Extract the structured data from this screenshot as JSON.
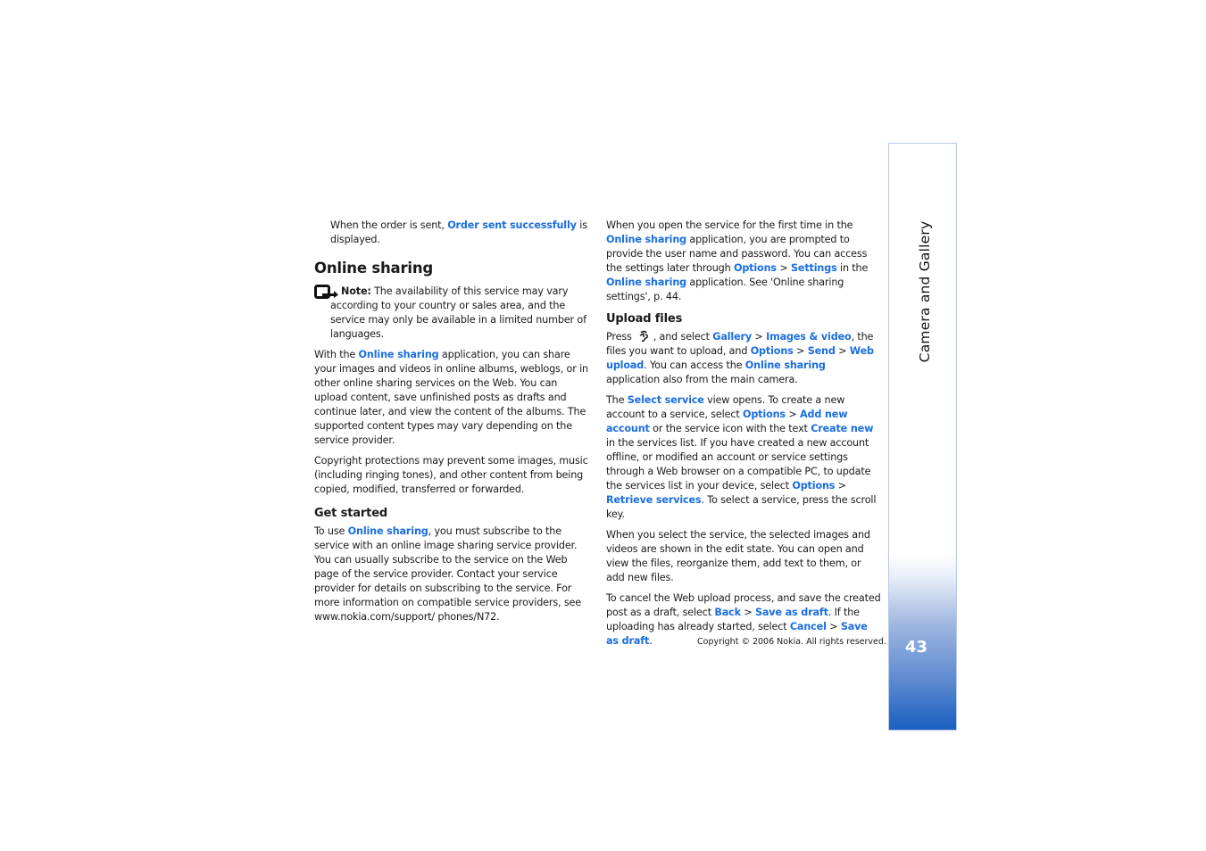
{
  "left_column": {
    "intro": {
      "pre": "When the order is sent, ",
      "link": "Order sent successfully",
      "post": " is displayed."
    },
    "section_title": "Online sharing",
    "note": {
      "label": "Note:",
      "text": " The availability of this service may vary according to your country or sales area, and the service may only be available in a limited number of languages."
    },
    "para1": {
      "pre": "With the ",
      "link": "Online sharing",
      "post": " application, you can share your images and videos in online albums, weblogs, or in other online sharing services on the Web. You can upload content, save unfinished posts as drafts and continue later, and view the content of the albums. The supported content types may vary depending on the service provider."
    },
    "para2": "Copyright protections may prevent some images, music (including ringing tones), and other content from being copied, modified, transferred or forwarded.",
    "get_started": {
      "title": "Get started",
      "pre": "To use ",
      "link": "Online sharing",
      "post": ", you must subscribe to the service with an online image sharing service provider. You can usually subscribe to the service on the Web page of the service provider. Contact your service provider for details on subscribing to the service. For more information on compatible service providers, see www.nokia.com/support/ phones/N72."
    }
  },
  "right_column": {
    "para1": {
      "t1": "When you open the service for the first time in the ",
      "l1": "Online sharing",
      "t2": " application, you are prompted to provide the user name and password. You can access the settings later through ",
      "l2": "Options",
      "t3": " > ",
      "l3": "Settings",
      "t4": " in the ",
      "l4": "Online sharing",
      "t5": " application. See 'Online sharing settings', p. 44."
    },
    "upload_title": "Upload files",
    "upload": {
      "t1": "Press",
      "key_icon": "menu-key-icon",
      "t2": ", and select ",
      "l1": "Gallery",
      "t3": " > ",
      "l2": "Images & video",
      "t4": ", the files you want to upload, and ",
      "l3": "Options",
      "t5": " > ",
      "l4": "Send",
      "t6": " > ",
      "l5": "Web upload",
      "t7": ". You can access the ",
      "l6": "Online sharing",
      "t8": " application also from the main camera."
    },
    "select_service": {
      "t1": "The ",
      "l1": "Select service",
      "t2": " view opens. To create a new account to a service, select ",
      "l2": "Options",
      "t3": " > ",
      "l3": "Add new account",
      "t4": " or the service icon with the text ",
      "l4": "Create new",
      "t5": " in the services list. If you have created a new account offline, or modified an account or service settings through a Web browser on a compatible PC, to update the services list in your device, select ",
      "l5": "Options",
      "t6": " > ",
      "l6": "Retrieve services",
      "t7": ". To select a service, press the scroll key."
    },
    "edit_state": "When you select the service, the selected images and videos are shown in the edit state. You can open and view the files, reorganize them, add text to them, or add new files.",
    "cancel": {
      "t1": "To cancel the Web upload process, and save the created post as a draft, select ",
      "l1": "Back",
      "t2": " > ",
      "l2": "Save as draft",
      "t3": ". If the uploading has already started, select ",
      "l3": "Cancel",
      "t4": " > ",
      "l4": "Save as draft",
      "t5": "."
    }
  },
  "footer": {
    "copyright": "Copyright © 2006 Nokia. All rights reserved."
  },
  "side_tab": {
    "title": "Camera and Gallery",
    "page_number": "43"
  },
  "colors": {
    "link": "#1a6ee0",
    "tab_gradient_bottom": "#1a5fc0"
  }
}
